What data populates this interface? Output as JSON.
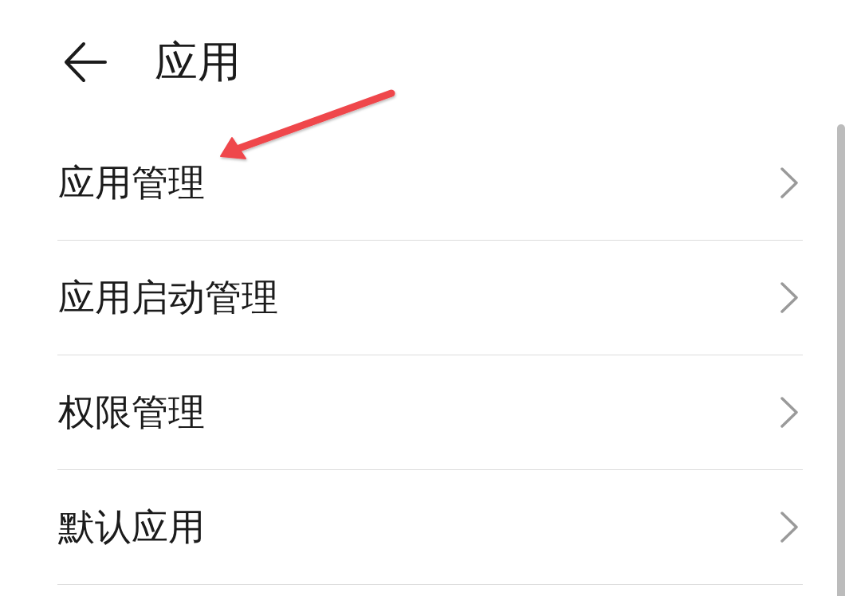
{
  "header": {
    "title": "应用"
  },
  "items": [
    {
      "label": "应用管理"
    },
    {
      "label": "应用启动管理"
    },
    {
      "label": "权限管理"
    },
    {
      "label": "默认应用"
    }
  ]
}
